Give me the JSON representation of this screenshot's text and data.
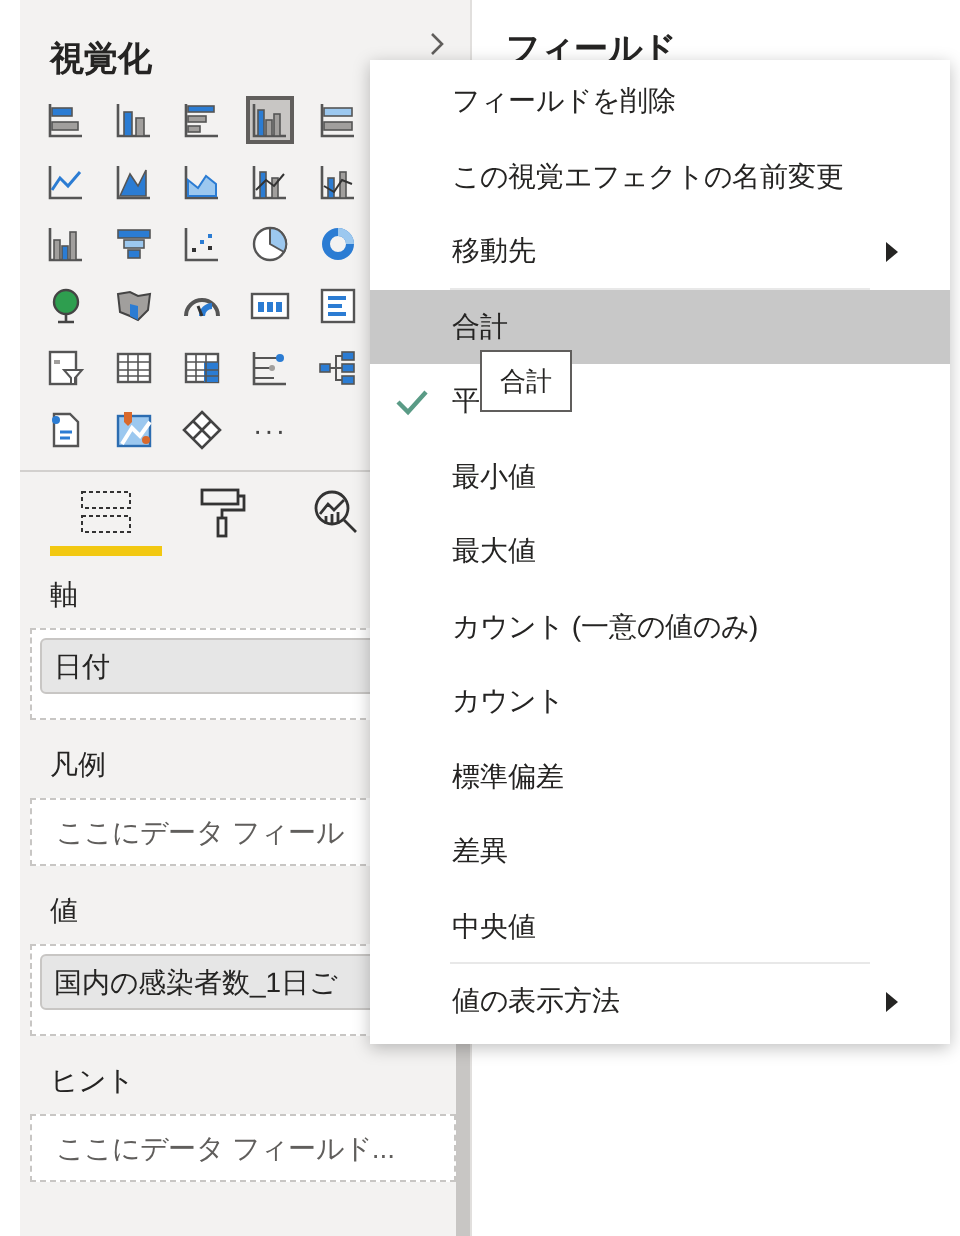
{
  "visualizations_pane": {
    "title": "視覚化",
    "visuals": [
      {
        "selected": false
      },
      {
        "selected": false
      },
      {
        "selected": false
      },
      {
        "selected": true
      },
      {
        "selected": false
      },
      {
        "selected": false
      },
      {
        "selected": false
      },
      {
        "selected": false
      },
      {
        "selected": false
      },
      {
        "selected": false
      },
      {
        "selected": false
      },
      {
        "selected": false
      },
      {
        "selected": false
      },
      {
        "selected": false
      },
      {
        "selected": false
      },
      {
        "selected": false
      },
      {
        "selected": false
      },
      {
        "selected": false
      },
      {
        "selected": false
      },
      {
        "selected": false
      },
      {
        "selected": false
      },
      {
        "selected": false
      },
      {
        "selected": false
      },
      {
        "selected": false
      },
      {
        "selected": false
      },
      {
        "selected": false
      },
      {
        "selected": false
      },
      {
        "selected": false
      }
    ],
    "more_glyph": "···",
    "pane_tabs": [
      {
        "selected": true
      },
      {
        "selected": false
      },
      {
        "selected": false
      }
    ],
    "wells": [
      {
        "label": "軸",
        "field": "日付"
      },
      {
        "label": "凡例",
        "placeholder": "ここにデータ フィール"
      },
      {
        "label": "値",
        "field": "国内の感染者数_1日ご"
      },
      {
        "label": "ヒント",
        "placeholder": "ここにデータ フィールド..."
      }
    ]
  },
  "fields_pane": {
    "title": "フィールド"
  },
  "context_menu": {
    "items": [
      {
        "kind": "item",
        "label": "フィールドを削除",
        "checked": false,
        "highlighted": false
      },
      {
        "kind": "item",
        "label": "この視覚エフェクトの名前変更",
        "checked": false,
        "highlighted": false
      },
      {
        "kind": "submenu",
        "label": "移動先",
        "checked": false,
        "highlighted": false
      },
      {
        "kind": "separator"
      },
      {
        "kind": "item",
        "label": "合計",
        "checked": false,
        "highlighted": true
      },
      {
        "kind": "item",
        "label": "平",
        "checked": true,
        "highlighted": false
      },
      {
        "kind": "item",
        "label": "最小値",
        "checked": false,
        "highlighted": false
      },
      {
        "kind": "item",
        "label": "最大値",
        "checked": false,
        "highlighted": false
      },
      {
        "kind": "item",
        "label": "カウント (一意の値のみ)",
        "checked": false,
        "highlighted": false
      },
      {
        "kind": "item",
        "label": "カウント",
        "checked": false,
        "highlighted": false
      },
      {
        "kind": "item",
        "label": "標準偏差",
        "checked": false,
        "highlighted": false
      },
      {
        "kind": "item",
        "label": "差異",
        "checked": false,
        "highlighted": false
      },
      {
        "kind": "item",
        "label": "中央値",
        "checked": false,
        "highlighted": false
      },
      {
        "kind": "separator"
      },
      {
        "kind": "submenu",
        "label": "値の表示方法",
        "checked": false,
        "highlighted": false
      }
    ],
    "tooltip": "合計"
  }
}
